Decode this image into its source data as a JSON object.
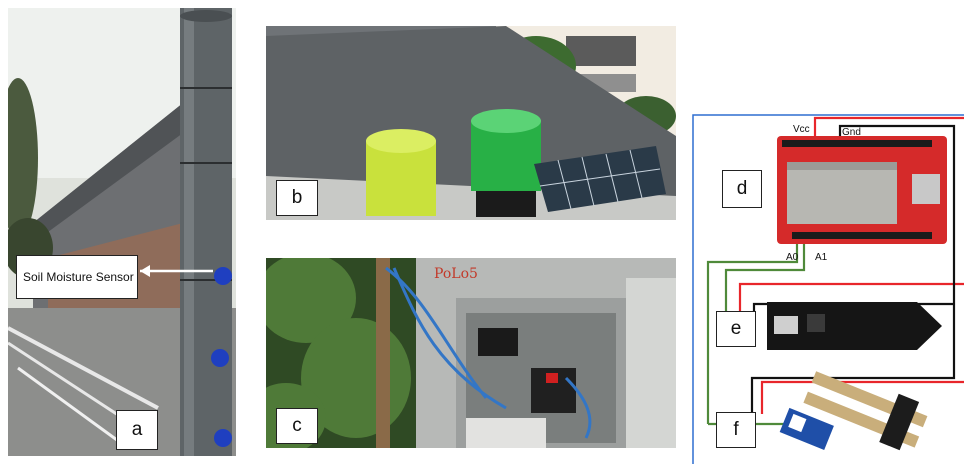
{
  "figure": {
    "panels": [
      {
        "id": "a",
        "label": "a"
      },
      {
        "id": "b",
        "label": "b"
      },
      {
        "id": "c",
        "label": "c"
      },
      {
        "id": "d",
        "label": "d"
      },
      {
        "id": "e",
        "label": "e"
      },
      {
        "id": "f",
        "label": "f"
      }
    ],
    "annotation_a": "Soil Moisture Sensor",
    "box_c_text": "PoLo5",
    "pins": {
      "vcc": "Vcc",
      "gnd": "Gnd",
      "a0": "A0",
      "a1": "A1"
    }
  },
  "colors": {
    "wire_red": "#e8262b",
    "wire_green": "#4f8a3a",
    "wire_black": "#111111",
    "frame_blue": "#2f6fd0",
    "board_red": "#d52a2a"
  }
}
